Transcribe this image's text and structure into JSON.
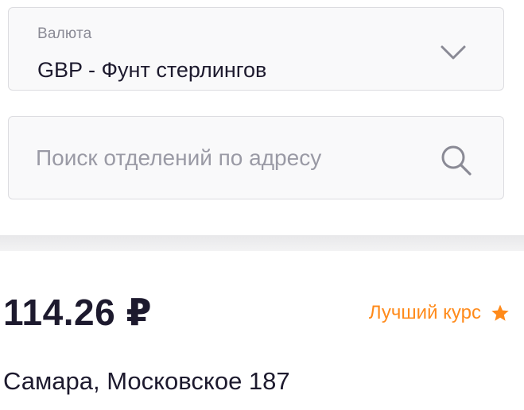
{
  "currency": {
    "caption": "Валюта",
    "selected": "GBP - Фунт стерлингов",
    "icon": "chevron-down-icon"
  },
  "search": {
    "placeholder": "Поиск отделений по адресу",
    "value": "",
    "icon": "search-icon"
  },
  "branch": {
    "rate": "114.26 ₽",
    "best_label": "Лучший курс",
    "best_icon": "star-icon",
    "address": "Самара, Московское 187"
  },
  "colors": {
    "text": "#1d1a2e",
    "muted": "#8a8a95",
    "accent": "#ff8a1a",
    "field_border": "#dcdce0",
    "field_bg": "#f9f9fa"
  }
}
